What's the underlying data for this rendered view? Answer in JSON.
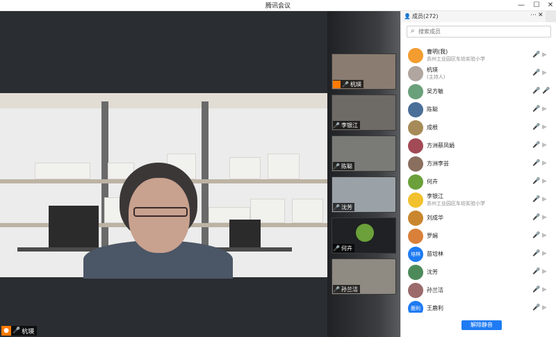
{
  "window": {
    "title": "腾讯会议",
    "controls": {
      "minimize": "—",
      "maximize": "☐",
      "close": "✕"
    }
  },
  "main": {
    "speaker_name": "杭瑛"
  },
  "thumbnails": [
    {
      "name": "杭瑛",
      "mic": "on",
      "bg": "#8a7c70"
    },
    {
      "name": "李银江",
      "mic": "off",
      "bg": "#6e6a66"
    },
    {
      "name": "陈聪",
      "mic": "off",
      "bg": "#7a7a76"
    },
    {
      "name": "沈芳",
      "mic": "off",
      "bg": "#9aa2a8"
    },
    {
      "name": "何卉",
      "mic": "off",
      "bg": "#1f2124"
    },
    {
      "name": "孙兰洁",
      "mic": "off",
      "bg": "#8f8a82"
    }
  ],
  "panel": {
    "title": "成员(272)",
    "more": "⋯",
    "close": "✕",
    "search_placeholder": "搜索成员",
    "members": [
      {
        "name": "曹明(我)",
        "sub": "苏州工业园区车坊实验小学",
        "avatar_color": "#f39c2f",
        "mic": "off",
        "cam": "off"
      },
      {
        "name": "杭瑛",
        "sub": "(主持人)",
        "avatar_color": "#b0a59f",
        "mic": "on",
        "cam": "off"
      },
      {
        "name": "吴方敏",
        "sub": "",
        "avatar_color": "#6aa07a",
        "mic": "active",
        "cam": "off"
      },
      {
        "name": "陈聪",
        "sub": "",
        "avatar_color": "#4a6f98",
        "mic": "off",
        "cam": "off"
      },
      {
        "name": "成根",
        "sub": "",
        "avatar_color": "#a68b58",
        "mic": "off",
        "cam": "off"
      },
      {
        "name": "方洲蔡凤娟",
        "sub": "",
        "avatar_color": "#a24a56",
        "mic": "off",
        "cam": "off"
      },
      {
        "name": "方洲李芸",
        "sub": "",
        "avatar_color": "#8a6f5f",
        "mic": "off",
        "cam": "off"
      },
      {
        "name": "何卉",
        "sub": "",
        "avatar_color": "#6ba03a",
        "mic": "off",
        "cam": "off"
      },
      {
        "name": "李银江",
        "sub": "苏州工业园区车坊实验小学",
        "avatar_color": "#f2c12e",
        "mic": "off",
        "cam": "off"
      },
      {
        "name": "刘成华",
        "sub": "",
        "avatar_color": "#c9862e",
        "mic": "off",
        "cam": "off"
      },
      {
        "name": "罗娴",
        "sub": "",
        "avatar_color": "#d9803a",
        "mic": "off",
        "cam": "off"
      },
      {
        "name": "苗培林",
        "sub": "",
        "avatar_color": "#1e7bf3",
        "avatar_text": "培林",
        "mic": "off",
        "cam": "off"
      },
      {
        "name": "沈芳",
        "sub": "",
        "avatar_color": "#4d8a5a",
        "mic": "off",
        "cam": "off"
      },
      {
        "name": "孙兰洁",
        "sub": "",
        "avatar_color": "#9b6b6b",
        "mic": "off",
        "cam": "off"
      },
      {
        "name": "王鹿利",
        "sub": "",
        "avatar_color": "#1e7bf3",
        "avatar_text": "鹿利",
        "mic": "off",
        "cam": "off"
      }
    ],
    "unmute_all": "解除静音"
  },
  "colors": {
    "accent": "#1e7bf3",
    "mic_muted": "#ff5a5a",
    "mic_active": "#1e7bf3",
    "cam_off": "#bdbdbd"
  }
}
